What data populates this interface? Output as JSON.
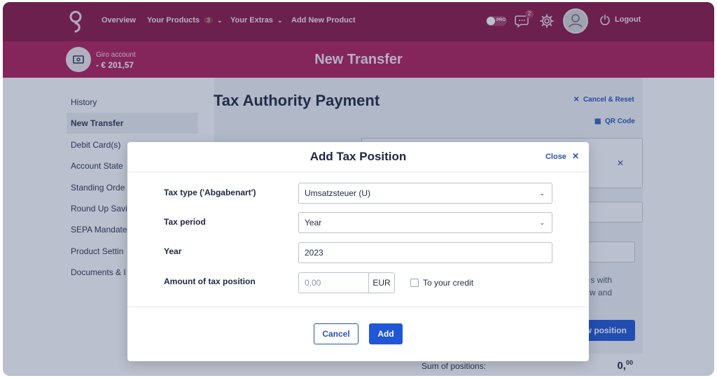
{
  "topnav": {
    "items": [
      {
        "label": "Overview"
      },
      {
        "label": "Your Products",
        "badge": "3"
      },
      {
        "label": "Your Extras"
      },
      {
        "label": "Add New Product"
      }
    ],
    "pro_label": "PRO",
    "notification_count": "2",
    "logout_label": "Logout"
  },
  "account": {
    "label": "Giro account",
    "balance": "- € 201,57"
  },
  "page": {
    "header_title": "New Transfer",
    "title": "Tax Authority Payment",
    "cancel_reset_label": "Cancel & Reset",
    "qr_code_label": "QR Code",
    "bg_text_line1": "s with",
    "bg_text_line2": "w and",
    "bg_button_label": "w position",
    "sum_label": "Sum of positions:",
    "sum_value_main": "0,",
    "sum_value_cents": "00"
  },
  "sidebar": {
    "items": [
      {
        "label": "History"
      },
      {
        "label": "New Transfer"
      },
      {
        "label": "Debit Card(s)"
      },
      {
        "label": "Account State"
      },
      {
        "label": "Standing Orde"
      },
      {
        "label": "Round Up Savi"
      },
      {
        "label": "SEPA Mandate"
      },
      {
        "label": "Product Settin"
      },
      {
        "label": "Documents & I"
      }
    ]
  },
  "modal": {
    "title": "Add Tax Position",
    "close_label": "Close",
    "fields": {
      "tax_type_label": "Tax type ('Abgabenart')",
      "tax_type_value": "Umsatzsteuer (U)",
      "tax_period_label": "Tax period",
      "tax_period_value": "Year",
      "year_label": "Year",
      "year_value": "2023",
      "amount_label": "Amount of tax position",
      "amount_placeholder": "0,00",
      "currency": "EUR",
      "credit_label": "To your credit"
    },
    "cancel_label": "Cancel",
    "add_label": "Add"
  },
  "colors": {
    "topnav_bg": "#8b1444",
    "subheader_bg": "#b01d58",
    "primary_button": "#2057d6",
    "link": "#2553b8"
  }
}
